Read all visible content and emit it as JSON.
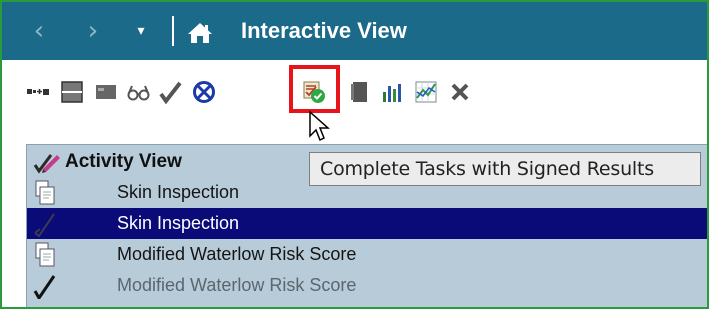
{
  "window": {
    "title": "Interactive View",
    "nav": {
      "back": "‹",
      "forward": "›",
      "menu": "▾"
    },
    "frame_color": "#2a9a3c",
    "titlebar_color": "#1b6a8a"
  },
  "toolbar": {
    "buttons": [
      "insert-row-icon",
      "collapse-rows-icon",
      "label-icon",
      "glasses-icon",
      "checkmark-icon",
      "cancel-icon",
      "complete-tasks-signed-results-icon",
      "document-icon",
      "bar-chart-icon",
      "line-chart-icon",
      "remove-icon"
    ],
    "highlight_color": "#e8141c"
  },
  "tooltip": {
    "text": "Complete Tasks with Signed Results"
  },
  "activity_view": {
    "header": "Activity View",
    "panel_color": "#b7ccd8",
    "rows": [
      {
        "icon": "document-stack-icon",
        "label": "Skin Inspection",
        "selected": false
      },
      {
        "icon": "checkmark-icon",
        "label": "Skin Inspection",
        "selected": true
      },
      {
        "icon": "document-stack-icon",
        "label": "Modified Waterlow Risk Score",
        "selected": false
      },
      {
        "icon": "checkmark-icon",
        "label": "Modified Waterlow Risk Score",
        "selected": false
      }
    ]
  }
}
